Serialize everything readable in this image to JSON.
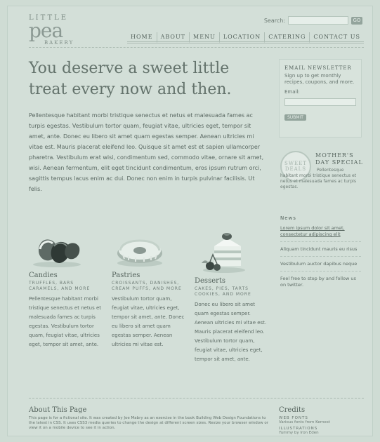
{
  "header": {
    "logo": {
      "line1": "LITTLE",
      "line2": "pea",
      "line3": "BAKERY"
    },
    "search": {
      "label": "Search:",
      "value": "",
      "button": "GO"
    },
    "nav": [
      "HOME",
      "ABOUT",
      "MENU",
      "LOCATION",
      "CATERING",
      "CONTACT US"
    ]
  },
  "main": {
    "headline": "You deserve a sweet little treat every now and then.",
    "intro": "Pellentesque habitant morbi tristique senectus et netus et malesuada fames ac turpis egestas. Vestibulum tortor quam, feugiat vitae, ultricies eget, tempor sit amet, ante. Donec eu libero sit amet quam egestas semper. Aenean ultricies mi vitae est. Mauris placerat eleifend leo. Quisque sit amet est et sapien ullamcorper pharetra. Vestibulum erat wisi, condimentum sed, commodo vitae, ornare sit amet, wisi. Aenean fermentum, elit eget tincidunt condimentum, eros ipsum rutrum orci, sagittis tempus lacus enim ac dui. Donec non enim in turpis pulvinar facilisis. Ut felis.",
    "products": [
      {
        "name": "Candies",
        "sub": "TRUFFLES, BARS CARAMELS, AND MORE",
        "text": "Pellentesque habitant morbi tristique senectus et netus et malesuada fames ac turpis egestas. Vestibulum tortor quam, feugiat vitae, ultricies eget, tempor sit amet, ante."
      },
      {
        "name": "Pastries",
        "sub": "CROISSANTS, DANISHES, CREAM PUFFS, AND MORE",
        "text": "Vestibulum tortor quam, feugiat vitae, ultricies eget, tempor sit amet, ante. Donec eu libero sit amet quam egestas semper. Aenean ultricies mi vitae est."
      },
      {
        "name": "Desserts",
        "sub": "CAKES, PIES, TARTS COOKIES, AND MORE",
        "text": "Donec eu libero sit amet quam egestas semper. Aenean ultricies mi vitae est. Mauris placerat eleifend leo. Vestibulum tortor quam, feugiat vitae, ultricies eget, tempor sit amet, ante."
      }
    ]
  },
  "sidebar": {
    "newsletter": {
      "title": "EMAIL NEWSLETTER",
      "desc": "Sign up to get monthly recipes, coupons, and more.",
      "email_label": "Email:",
      "email_value": "",
      "button": "SUBMIT"
    },
    "special": {
      "badge_line1": "SWEET",
      "badge_line2": "DEALS",
      "title": "MOTHER'S DAY SPECIAL",
      "desc": "Pellentesque habitant morbi tristique senectus et netus et malesuada fames ac turpis egestas."
    },
    "news": {
      "title": "News",
      "items": [
        {
          "text": "Lorem ipsum dolor sit amet, consectetur adipiscing elit"
        },
        {
          "text": "Aliquam tincidunt mauris eu risus"
        },
        {
          "text": "Vestibulum auctor dapibus neque"
        },
        {
          "text": "Feel free to stop by and follow us on twitter."
        }
      ]
    }
  },
  "footer": {
    "about_title": "About This Page",
    "about_text": "This page is for a fictional site. It was created by Joe Mabry as an exercise in the book Building Web Design Foundations to the latest in CSS. It uses CSS3 media queries to change the design at different screen sizes. Resize your browser window or view it on a mobile device to see it in action.",
    "credits_title": "Credits",
    "web_fonts_label": "WEB FONTS",
    "web_fonts_value": "Various fonts from Kernest",
    "illustrations_label": "ILLUSTRATIONS",
    "illustrations_value": "Yummy by Iron Eden"
  },
  "colors": {
    "background": "#cfdcd4",
    "text": "#4d5a55",
    "accent": "#93a49c"
  }
}
